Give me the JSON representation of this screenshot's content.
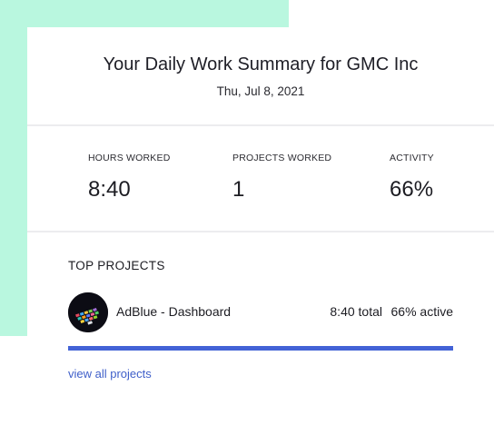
{
  "header": {
    "title": "Your Daily Work Summary for GMC Inc",
    "date": "Thu, Jul 8, 2021"
  },
  "stats": [
    {
      "label": "HOURS WORKED",
      "value": "8:40"
    },
    {
      "label": "PROJECTS WORKED",
      "value": "1"
    },
    {
      "label": "ACTIVITY",
      "value": "66%"
    }
  ],
  "top_projects": {
    "heading": "TOP PROJECTS",
    "items": [
      {
        "name": "AdBlue - Dashboard",
        "total": "8:40 total",
        "active": "66% active",
        "share_of_time": 1.0,
        "avatar_icon": "project-thumbnail-icon"
      }
    ],
    "link_label": "view all projects"
  },
  "colors": {
    "accent_backdrop": "#b9f7df",
    "bar": "#4362d6",
    "link": "#3f5fc9"
  }
}
